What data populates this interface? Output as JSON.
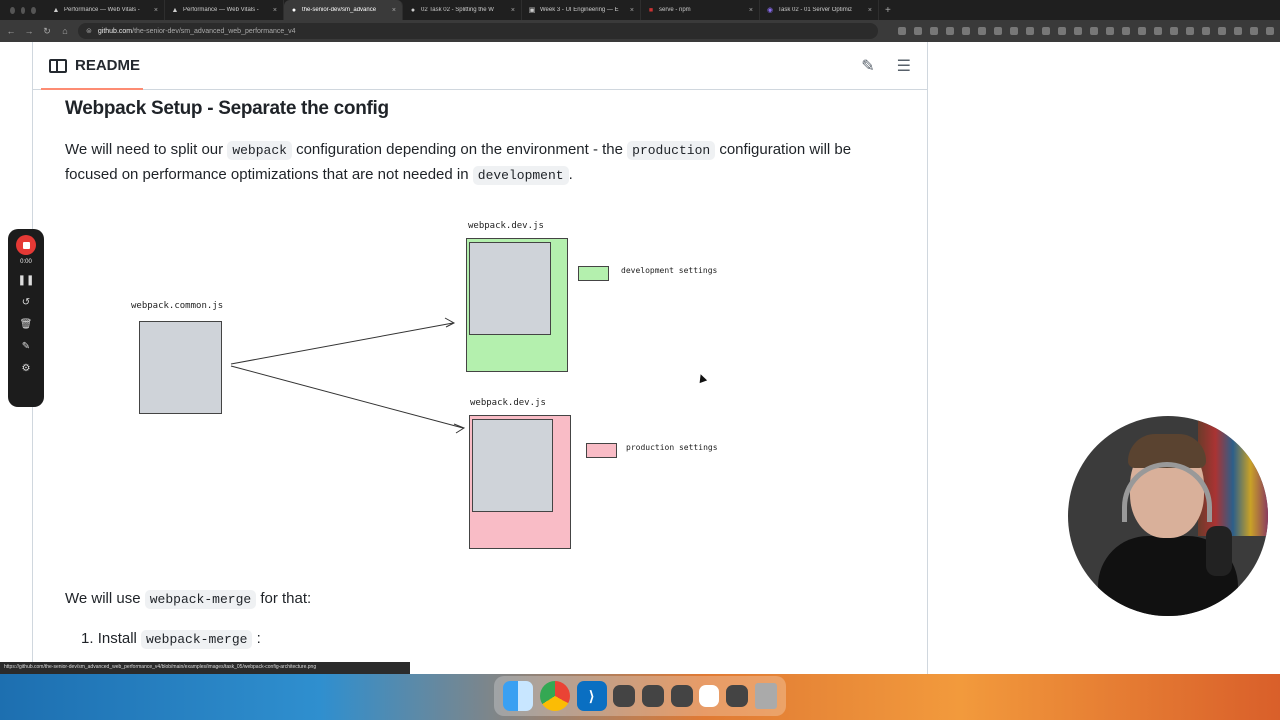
{
  "browser": {
    "tabs": [
      {
        "title": "Performance — Web Vitals -",
        "icon": "vercel-icon"
      },
      {
        "title": "Performance — Web Vitals -",
        "icon": "vercel-icon"
      },
      {
        "title": "the-senior-dev/sm_advance",
        "icon": "github-icon",
        "active": true
      },
      {
        "title": "02 Task 02 - Splitting the W",
        "icon": "github-icon"
      },
      {
        "title": "Week 3 - UI Engineering — E",
        "icon": "doc-icon"
      },
      {
        "title": "serve - npm",
        "icon": "npm-icon"
      },
      {
        "title": "Task 02 - 01 Server Optimiz",
        "icon": "doc-icon"
      }
    ],
    "url_host": "github.com",
    "url_path": "/the-senior-dev/sm_advanced_web_performance_v4",
    "status_url": "https://github.com/the-senior-dev/sm_advanced_web_performance_v4/blob/main/examples/images/task_05/webpack-config-architecture.png"
  },
  "readme": {
    "header_title": "README",
    "heading": "Webpack Setup - Separate the config",
    "intro": {
      "t1": "We will need to split our ",
      "c1": "webpack",
      "t2": " configuration depending on the environment - the ",
      "c2": "production",
      "t3": " configuration will be focused on performance optimizations that are not needed in ",
      "c3": "development",
      "t4": "."
    },
    "diagram": {
      "common_label": "webpack.common.js",
      "dev_label": "webpack.dev.js",
      "prod_label": "webpack.dev.js",
      "dev_legend": "development settings",
      "prod_legend": "production settings"
    },
    "after": {
      "t1": "We will use ",
      "c1": "webpack-merge",
      "t2": " for that:"
    },
    "step1": {
      "num": "1.",
      "t1": "Install ",
      "c1": "webpack-merge",
      "t2": ":"
    }
  },
  "recorder": {
    "time": "0:00"
  },
  "colors": {
    "green": "#b4f0ae",
    "pink": "#f9bcc6",
    "gray": "#cfd3d9",
    "accent": "#fd8c73",
    "record": "#e53935"
  }
}
